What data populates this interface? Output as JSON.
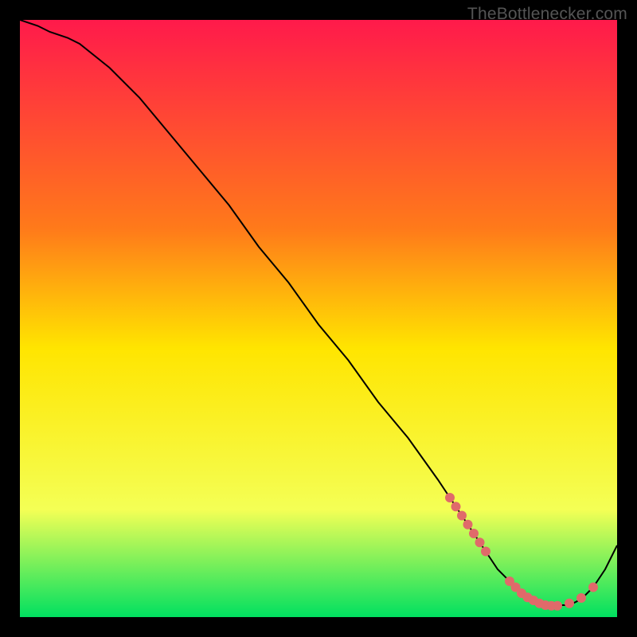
{
  "watermark": "TheBottlenecker.com",
  "chart_data": {
    "type": "line",
    "title": "",
    "xlabel": "",
    "ylabel": "",
    "xlim": [
      0,
      100
    ],
    "ylim": [
      0,
      100
    ],
    "grid": false,
    "series": [
      {
        "name": "bottleneck-curve",
        "x": [
          0,
          3,
          5,
          8,
          10,
          15,
          20,
          25,
          30,
          35,
          40,
          45,
          50,
          55,
          60,
          65,
          70,
          72,
          74,
          76,
          78,
          80,
          82,
          84,
          86,
          88,
          90,
          92,
          94,
          96,
          98,
          100
        ],
        "y": [
          100,
          99,
          98,
          97,
          96,
          92,
          87,
          81,
          75,
          69,
          62,
          56,
          49,
          43,
          36,
          30,
          23,
          20,
          17,
          14,
          11,
          8,
          6,
          4,
          3,
          2,
          2,
          2,
          3,
          5,
          8,
          12
        ]
      }
    ],
    "markers": {
      "name": "highlight-dots",
      "x": [
        72,
        73,
        74,
        75,
        76,
        77,
        78,
        82,
        83,
        84,
        85,
        86,
        87,
        88,
        89,
        90,
        92,
        94,
        96
      ],
      "y": [
        20,
        18.5,
        17,
        15.5,
        14,
        12.5,
        11,
        6,
        5,
        4,
        3.3,
        2.8,
        2.3,
        2,
        1.9,
        1.9,
        2.3,
        3.2,
        5
      ]
    },
    "background_gradient": {
      "top_color": "#ff1a4b",
      "mid1_color": "#ff7a1a",
      "mid2_color": "#ffe500",
      "mid3_color": "#f4ff55",
      "bottom_color": "#00e060"
    }
  }
}
